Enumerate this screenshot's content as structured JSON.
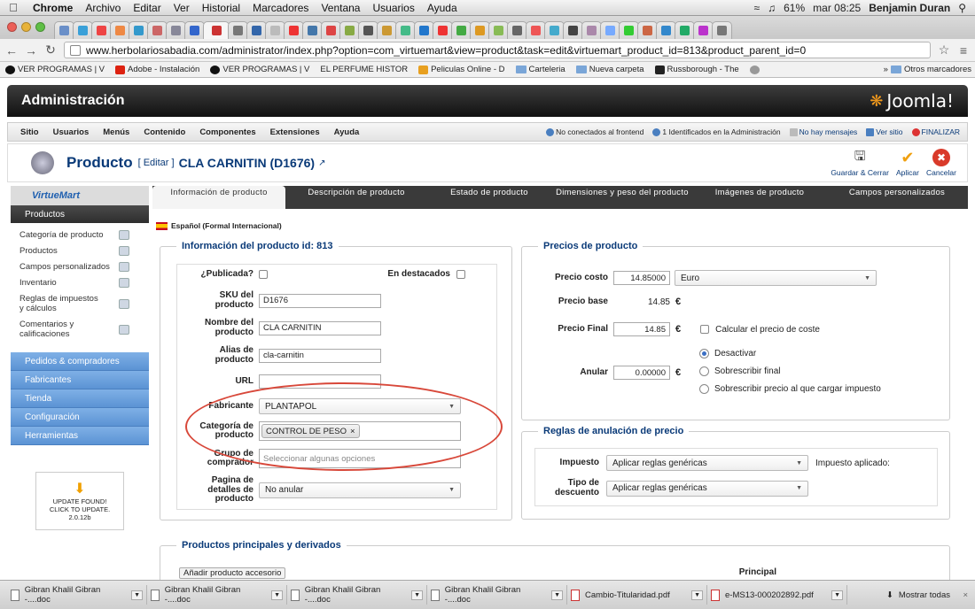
{
  "os_menubar": {
    "app": "Chrome",
    "menus": [
      "Archivo",
      "Editar",
      "Ver",
      "Historial",
      "Marcadores",
      "Ventana",
      "Usuarios",
      "Ayuda"
    ],
    "battery": "61%",
    "clock": "mar 08:25",
    "user": "Benjamin Duran"
  },
  "browser": {
    "url": "www.herbolariosabadia.com/administrator/index.php?option=com_virtuemart&view=product&task=edit&virtuemart_product_id=813&product_parent_id=0",
    "bookmarks": [
      "VER PROGRAMAS | V",
      "Adobe - Instalación",
      "VER PROGRAMAS | V",
      "EL PERFUME HISTOR",
      "Peliculas Online - D",
      "Carteleria",
      "Nueva carpeta",
      "Russborough - The"
    ],
    "other_bookmarks": "Otros marcadores"
  },
  "joomla": {
    "admin_title": "Administración",
    "logo_text": "Joomla!",
    "menu": [
      "Sitio",
      "Usuarios",
      "Menús",
      "Contenido",
      "Componentes",
      "Extensiones",
      "Ayuda"
    ],
    "status": {
      "frontend": "No conectados al frontend",
      "admins": "1 Identificados en la Administración",
      "messages": "No hay mensajes",
      "view_site": "Ver sitio",
      "logout": "FINALIZAR"
    }
  },
  "title": {
    "main": "Producto",
    "edit": "[ Editar ]",
    "name": "CLA CARNITIN (D1676)"
  },
  "toolbar": {
    "save_close": "Guardar & Cerrar",
    "apply": "Aplicar",
    "cancel": "Cancelar"
  },
  "sidebar": {
    "logo": "VirtueMart",
    "section": "Productos",
    "items": [
      "Categoría de producto",
      "Productos",
      "Campos personalizados",
      "Inventario",
      "Reglas de impuestos y cálculos",
      "Comentarios y calificaciones"
    ],
    "groups": [
      "Pedidos & compradores",
      "Fabricantes",
      "Tienda",
      "Configuración",
      "Herramientas"
    ],
    "update": {
      "line1": "UPDATE FOUND!",
      "line2": "CLICK TO UPDATE.",
      "version": "2.0.12b"
    }
  },
  "tabs": [
    "Información de producto",
    "Descripción de producto",
    "Estado de producto",
    "Dimensiones y peso del producto",
    "Imágenes de producto",
    "Campos personalizados"
  ],
  "language": "Español (Formal Internacional)",
  "info": {
    "legend": "Información del producto id: 813",
    "published_label": "¿Publicada?",
    "featured_label": "En destacados",
    "sku_label": "SKU del producto",
    "sku": "D1676",
    "name_label": "Nombre del producto",
    "name": "CLA CARNITIN",
    "alias_label": "Alias de producto",
    "alias": "cla-carnitin",
    "url_label": "URL",
    "url": "",
    "manufacturer_label": "Fabricante",
    "manufacturer": "PLANTAPOL",
    "category_label": "Categoría de producto",
    "category": "CONTROL DE PESO",
    "shopper_label": "Grupo de comprador",
    "shopper_placeholder": "Seleccionar algunas opciones",
    "page_label": "Pagina de detalles de producto",
    "page": "No anular"
  },
  "prices": {
    "legend": "Precios de producto",
    "cost_label": "Precio costo",
    "cost": "14.85000",
    "currency": "Euro",
    "base_label": "Precio base",
    "base": "14.85",
    "final_label": "Precio Final",
    "final": "14.85",
    "euro": "€",
    "calc_cost": "Calcular el precio de coste",
    "override_label": "Anular",
    "override": "0.00000",
    "radio": [
      "Desactivar",
      "Sobrescribir final",
      "Sobrescribir precio al que cargar impuesto"
    ]
  },
  "rules": {
    "legend": "Reglas de anulación de precio",
    "tax_label": "Impuesto",
    "tax": "Aplicar reglas genéricas",
    "applied": "Impuesto aplicado:",
    "discount_label": "Tipo de descuento",
    "discount": "Aplicar reglas genéricas"
  },
  "related": {
    "legend": "Productos principales y derivados",
    "add": "Añadir producto accesorio",
    "main": "Principal"
  },
  "downloads": [
    "Gibran Khalil Gibran -....doc",
    "Gibran Khalil Gibran -....doc",
    "Gibran Khalil Gibran -....doc",
    "Gibran Khalil Gibran -....doc",
    "Cambio-Titularidad.pdf",
    "e-MS13-000202892.pdf"
  ],
  "show_all": "Mostrar todas"
}
